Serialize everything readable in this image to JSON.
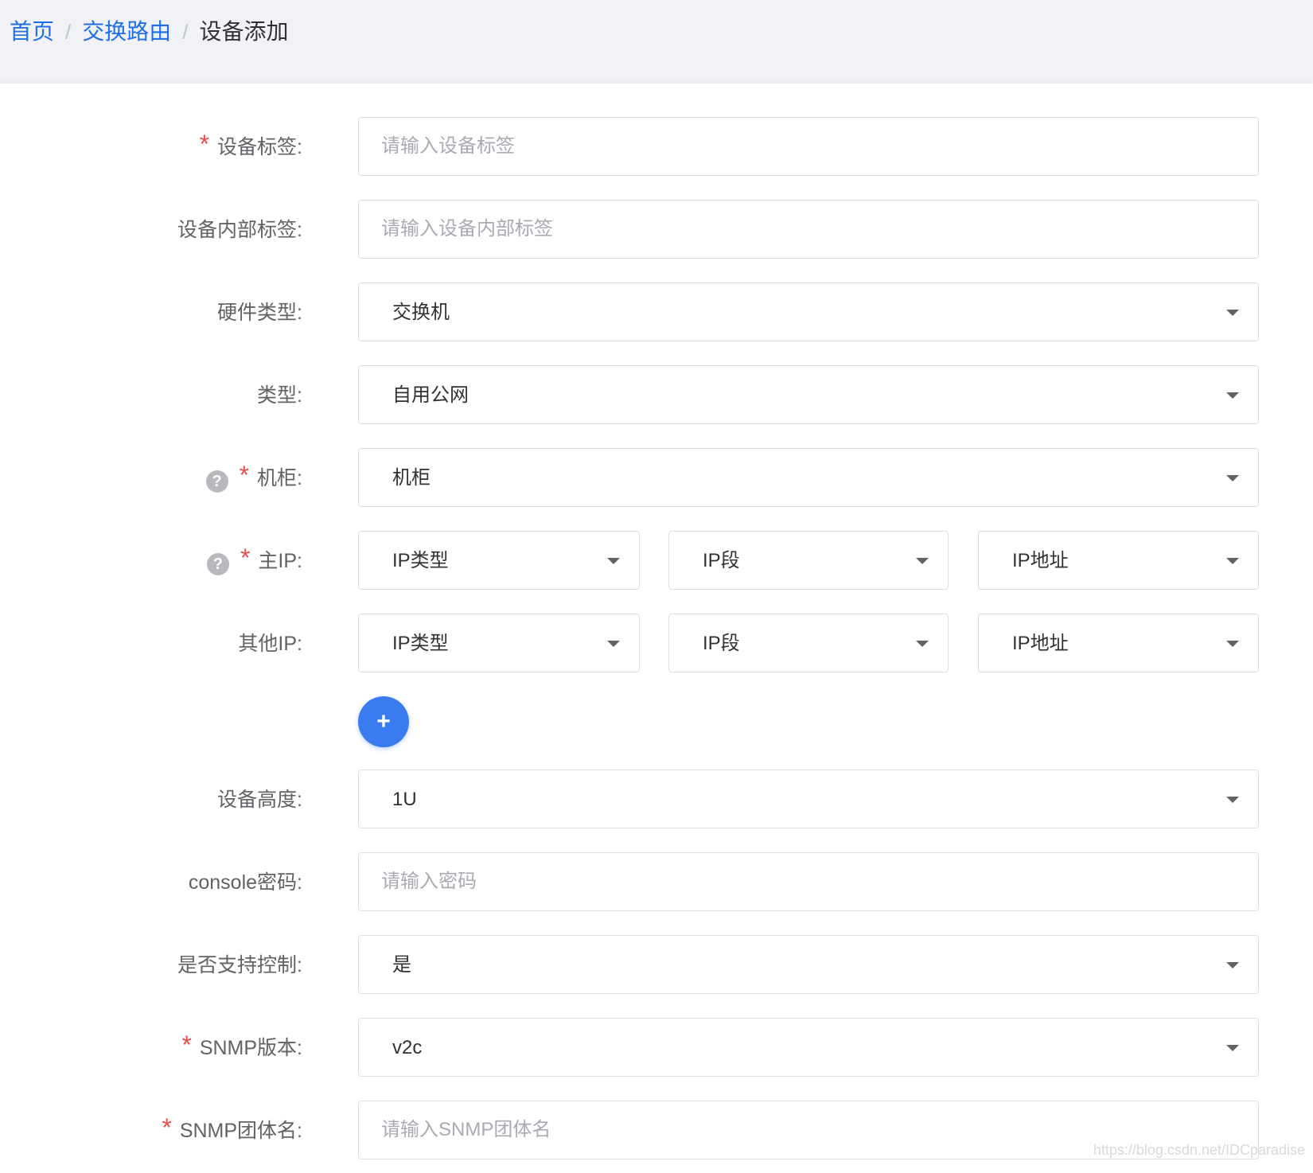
{
  "breadcrumb": {
    "home": "首页",
    "section": "交换路由",
    "current": "设备添加",
    "separator": "/"
  },
  "form": {
    "device_tag": {
      "label": "设备标签:",
      "placeholder": "请输入设备标签",
      "required": true
    },
    "internal_tag": {
      "label": "设备内部标签:",
      "placeholder": "请输入设备内部标签"
    },
    "hardware_type": {
      "label": "硬件类型:",
      "value": "交换机"
    },
    "type": {
      "label": "类型:",
      "value": "自用公网"
    },
    "cabinet": {
      "label": "机柜:",
      "value": "机柜",
      "required": true,
      "help": "?"
    },
    "main_ip": {
      "label": "主IP:",
      "required": true,
      "help": "?",
      "ip_type": "IP类型",
      "ip_segment": "IP段",
      "ip_address": "IP地址"
    },
    "other_ip": {
      "label": "其他IP:",
      "ip_type": "IP类型",
      "ip_segment": "IP段",
      "ip_address": "IP地址"
    },
    "add_button": "+",
    "device_height": {
      "label": "设备高度:",
      "value": "1U"
    },
    "console_password": {
      "label": "console密码:",
      "placeholder": "请输入密码"
    },
    "support_control": {
      "label": "是否支持控制:",
      "value": "是"
    },
    "snmp_version": {
      "label": "SNMP版本:",
      "value": "v2c",
      "required": true
    },
    "snmp_community": {
      "label": "SNMP团体名:",
      "placeholder": "请输入SNMP团体名",
      "required": true
    },
    "required_mark": "*"
  },
  "watermark": "https://blog.csdn.net/IDCparadise",
  "colors": {
    "link": "#1f6fe8",
    "required": "#f04b4b",
    "primary": "#3a7bf0"
  }
}
